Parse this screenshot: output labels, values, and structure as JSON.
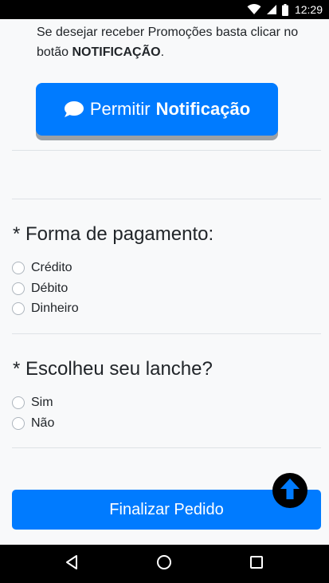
{
  "status_bar": {
    "time": "12:29",
    "icons": [
      "wifi-icon",
      "signal-icon",
      "battery-icon"
    ]
  },
  "promo": {
    "text": "Se desejar receber Promoções basta clicar no botão ",
    "bold": "NOTIFICAÇÃO",
    "suffix": "."
  },
  "notification_button": {
    "icon": "chat-bubble-icon",
    "label_regular": "Permitir",
    "label_bold": "Notificação"
  },
  "payment": {
    "title": "* Forma de pagamento:",
    "options": [
      "Crédito",
      "Débito",
      "Dinheiro"
    ]
  },
  "sandwich": {
    "title": "* Escolheu seu lanche?",
    "options": [
      "Sim",
      "Não"
    ]
  },
  "submit_button": {
    "label": "Finalizar Pedido"
  },
  "scroll_top_button": {
    "icon": "arrow-up-icon"
  },
  "nav_bar": {
    "buttons": [
      "back-icon",
      "home-icon",
      "recents-icon"
    ]
  },
  "colors": {
    "primary": "#007bff",
    "background": "#f8f9fa",
    "text": "#212529",
    "divider": "#dee2e6",
    "system_bars": "#000000"
  }
}
